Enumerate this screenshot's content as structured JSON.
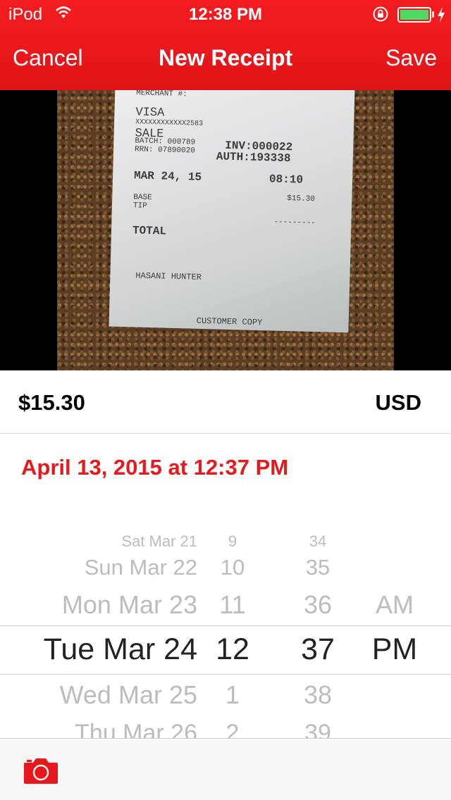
{
  "status": {
    "carrier": "iPod",
    "time": "12:38 PM",
    "battery_level": 1.0,
    "colors": {
      "battery": "#4cd964"
    }
  },
  "nav": {
    "cancel_label": "Cancel",
    "title": "New Receipt",
    "save_label": "Save",
    "background": "#e8171b"
  },
  "receipt_photo": {
    "merchant": "MERCHANT #:",
    "card_type": "VISA",
    "card_number": "XXXXXXXXXXXX2583",
    "transaction": "SALE",
    "batch": "BATCH: 000789",
    "rrn": "RRN: 07890020",
    "inv": "INV:000022",
    "auth": "AUTH:193338",
    "date": "MAR 24, 15",
    "time": "08:10",
    "base_label": "BASE",
    "tip_label": "TIP",
    "base_amount": "$15.30",
    "tip_line": "---------",
    "total_label": "TOTAL",
    "name": "HASANI HUNTER",
    "copy": "CUSTOMER COPY"
  },
  "amount": {
    "value": "$15.30",
    "currency": "USD"
  },
  "date_text": "April 13, 2015 at 12:37 PM",
  "picker": {
    "rows": [
      {
        "day": "Sat Mar 21",
        "hour": "9",
        "minute": "34",
        "ampm": ""
      },
      {
        "day": "Sun Mar 22",
        "hour": "10",
        "minute": "35",
        "ampm": ""
      },
      {
        "day": "Mon Mar 23",
        "hour": "11",
        "minute": "36",
        "ampm": "AM"
      },
      {
        "day": "Tue Mar 24",
        "hour": "12",
        "minute": "37",
        "ampm": "PM"
      },
      {
        "day": "Wed Mar 25",
        "hour": "1",
        "minute": "38",
        "ampm": ""
      },
      {
        "day": "Thu Mar 26",
        "hour": "2",
        "minute": "39",
        "ampm": ""
      }
    ]
  },
  "footer": {
    "camera_icon": "camera-icon",
    "accent": "#e8171b"
  }
}
